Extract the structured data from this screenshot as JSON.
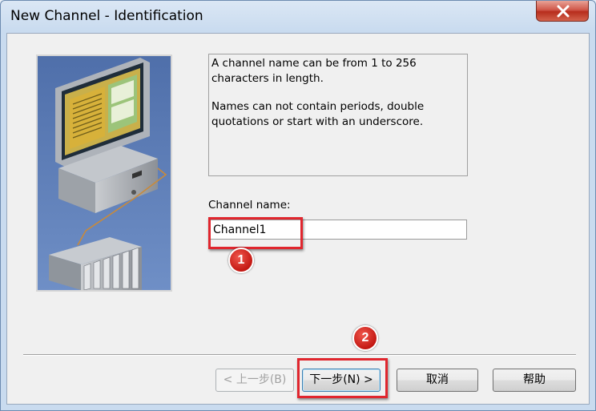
{
  "window": {
    "title": "New Channel - Identification",
    "close_glyph": "✕"
  },
  "description": {
    "line1": "A channel name can be from 1 to 256 characters in length.",
    "line2": "Names can not contain periods, double quotations or start with an underscore."
  },
  "channel_name": {
    "label": "Channel name:",
    "value": "Channel1"
  },
  "annotations": {
    "step1": "1",
    "step2": "2",
    "color": "#e0262e"
  },
  "buttons": {
    "back": "< 上一步(B)",
    "next": "下一步(N) >",
    "cancel": "取消",
    "help": "帮助"
  },
  "icons": {
    "illustration": "computer-plc-network-illustration",
    "close": "close-icon"
  }
}
